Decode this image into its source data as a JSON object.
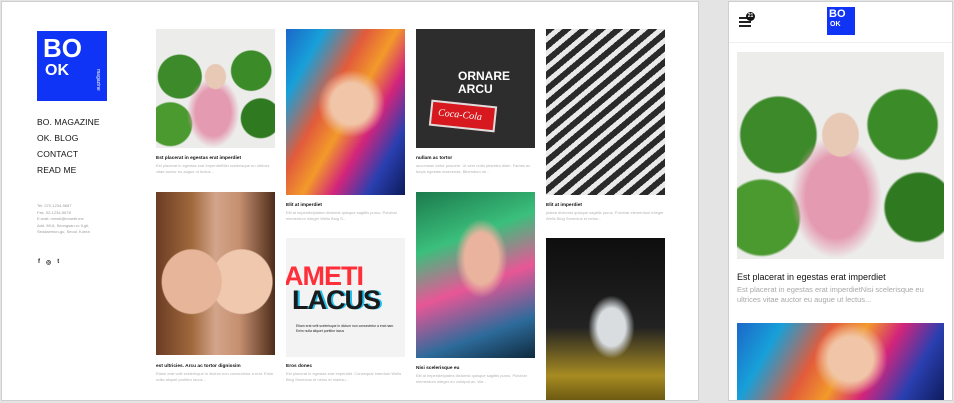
{
  "desktop": {
    "logo": {
      "line1": "BO",
      "line2": "OK",
      "sub": "magazine"
    },
    "nav": [
      "BO. MAGAZINE",
      "OK. BLOG",
      "CONTACT",
      "READ ME"
    ],
    "contact": [
      "Tel. 070-1234-5687",
      "Fax. 02-1234-5678",
      "E-mail. mnwh@mnwth.me",
      "Add. 89-8, Seongsan-ro 9-gil,",
      "Seodaemun-gu, Seoul, Korea"
    ],
    "social": [
      "f",
      "◎",
      "t"
    ],
    "cards": [
      {
        "title": "Est placerat in egestas erat imperdiet",
        "desc": "Est placerat in egestas erat imperdietNisi scelerisque eu ultrices vitae auctor eu augue ut lectus..."
      },
      {
        "title": "Elit at imperdiet",
        "desc": "Elit at imperdietplatea dictumst quisque sagittis purus. Pulvinar elementum integer Wells Blog S..."
      },
      {
        "title": "nullam ac tortor",
        "desc": "accumsan tortor posuere. Ut sem nulla pharetra diam. Fames ac turpis egestas maecenas. Bibendum ne..."
      },
      {
        "title": "Elit at imperdiet",
        "desc": "platea dictumst quisque sagittis purus. Pulvinar elementum integer Wells Blog Senectus et netus..."
      },
      {
        "title": "est ultricies. Arcu ac tortor dignissim",
        "desc": "Etiam erat velit scelerisque in dictum non consectetur a erat. Enim nulla aliquet porttitor lacus..."
      },
      {
        "title": "Eros donec",
        "desc": "Est placerat in egestas erat imperdiet. Consequat interdum Wells Blog Senectus et netus et malesu..."
      },
      {
        "title": "Nisi scelerisque eu",
        "desc": "Elit at imperdietplatea dictumst quisque sagittis purus. Pulvinar elementum integer eu volutpat ac. We..."
      }
    ],
    "poster": {
      "line1": "ORNARE",
      "line2": "ARCU",
      "brand": "Coca-Cola"
    },
    "typo": {
      "line1": "AMETI",
      "line2": "LACUS",
      "caption": "Etiam erat velit scelerisque in dictum non consectetur a erat nam. Enim nulla aliquet porttitor lacus"
    }
  },
  "mobile": {
    "logo": {
      "line1": "BO",
      "line2": "OK"
    },
    "badge": "21",
    "post_title": "Est placerat in egestas erat imperdiet",
    "post_desc": "Est placerat in egestas erat imperdietNisi scelerisque eu ultrices vitae auctor eu augue ut lectus..."
  },
  "colors": {
    "brand": "#1034f5",
    "text": "#111111",
    "muted": "#a8a8a8"
  },
  "icons": {
    "menu": "hamburger-icon",
    "facebook": "facebook-icon",
    "instagram": "instagram-icon",
    "twitter": "twitter-icon"
  }
}
